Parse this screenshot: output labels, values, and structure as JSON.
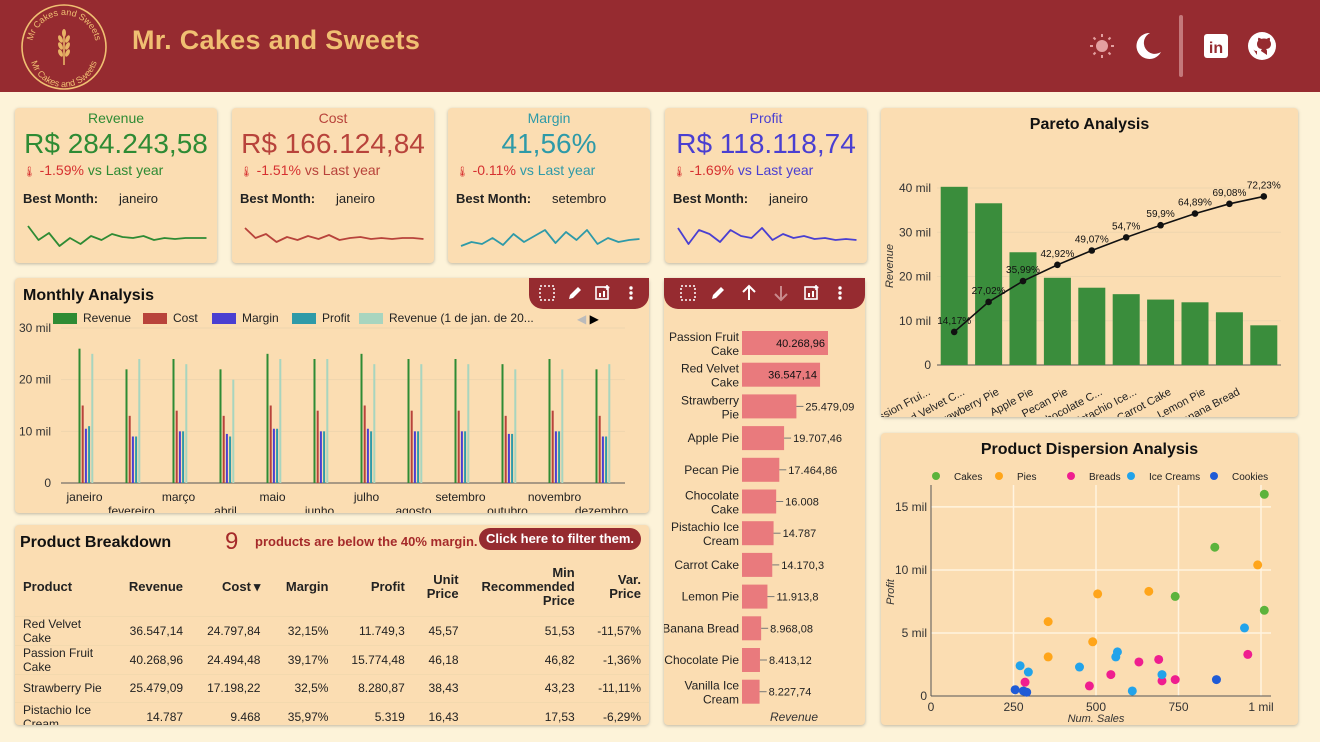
{
  "header": {
    "title": "Mr. Cakes and Sweets",
    "logo_text_top": "Mr Cakes and Sweets",
    "logo_text_bottom": "Mr Cakes and Sweets",
    "icons": [
      "sun-icon",
      "moon-icon",
      "linkedin-icon",
      "github-icon"
    ],
    "linkedin_label": "in"
  },
  "kpis": [
    {
      "title": "Revenue",
      "value": "R$ 284.243,58",
      "delta": "-1.59%",
      "delta_suffix": "vs Last year",
      "best_label": "Best Month:",
      "best_month": "janeiro",
      "color": "#2e8b34"
    },
    {
      "title": "Cost",
      "value": "R$ 166.124,84",
      "delta": "-1.51%",
      "delta_suffix": "vs Last year",
      "best_label": "Best Month:",
      "best_month": "janeiro",
      "color": "#b8433b"
    },
    {
      "title": "Margin",
      "value": "41,56%",
      "delta": "-0.11%",
      "delta_suffix": "vs Last year",
      "best_label": "Best Month:",
      "best_month": "setembro",
      "color": "#2e9aa8"
    },
    {
      "title": "Profit",
      "value": "R$ 118.118,74",
      "delta": "-1.69%",
      "delta_suffix": "vs Last year",
      "best_label": "Best Month:",
      "best_month": "janeiro",
      "color": "#4a3fd1"
    }
  ],
  "monthly": {
    "title": "Monthly Analysis",
    "legend": [
      {
        "name": "Revenue",
        "color": "#2e8b34"
      },
      {
        "name": "Cost",
        "color": "#b8433b"
      },
      {
        "name": "Margin",
        "color": "#4a3fd1"
      },
      {
        "name": "Profit",
        "color": "#2e9aa8"
      },
      {
        "name": "Revenue (1 de jan. de 20...",
        "color": "#a8d5bf"
      }
    ],
    "yticks": [
      "30 mil",
      "20 mil",
      "10 mil",
      "0"
    ]
  },
  "product_breakdown": {
    "title": "Product Breakdown",
    "count": "9",
    "message": "products are below the 40% margin.",
    "filter_button": "Click here to filter them.",
    "columns": [
      "Product",
      "Revenue",
      "Cost",
      "Margin",
      "Profit",
      "Unit Price",
      "Min Recommended Price",
      "Var. Price"
    ],
    "sort_indicator": "▾",
    "rows": [
      [
        "Red Velvet Cake",
        "36.547,14",
        "24.797,84",
        "32,15%",
        "11.749,3",
        "45,57",
        "51,53",
        "-11,57%"
      ],
      [
        "Passion Fruit Cake",
        "40.268,96",
        "24.494,48",
        "39,17%",
        "15.774,48",
        "46,18",
        "46,82",
        "-1,36%"
      ],
      [
        "Strawberry Pie",
        "25.479,09",
        "17.198,22",
        "32,5%",
        "8.280,87",
        "38,43",
        "43,23",
        "-11,11%"
      ],
      [
        "Pistachio Ice Cream",
        "14.787",
        "9.468",
        "35,97%",
        "5.319",
        "16,43",
        "17,53",
        "-6,29%"
      ]
    ]
  },
  "revenue_bar": {
    "axis_label": "Revenue"
  },
  "pareto": {
    "title": "Pareto Analysis",
    "ylabel": "Revenue",
    "yticks": [
      "40 mil",
      "30 mil",
      "20 mil",
      "10 mil",
      "0"
    ]
  },
  "dispersion": {
    "title": "Product Dispersion Analysis",
    "ylabel": "Profit",
    "xlabel": "Num. Sales",
    "yticks": [
      "15 mil",
      "10 mil",
      "5 mil",
      "0"
    ],
    "xticks": [
      "0",
      "250",
      "500",
      "750",
      "1 mil"
    ]
  },
  "chart_data": [
    {
      "type": "bar",
      "title": "Monthly Analysis",
      "categories": [
        "janeiro",
        "fevereiro",
        "março",
        "abril",
        "maio",
        "junho",
        "julho",
        "agosto",
        "setembro",
        "outubro",
        "novembro",
        "dezembro"
      ],
      "ylim": [
        0,
        30000
      ],
      "series": [
        {
          "name": "Revenue",
          "values": [
            26000,
            22000,
            24000,
            22000,
            25000,
            24000,
            25000,
            24000,
            24000,
            23000,
            24000,
            22000
          ]
        },
        {
          "name": "Cost",
          "values": [
            15000,
            13000,
            14000,
            13000,
            15000,
            14000,
            15000,
            14000,
            14000,
            13000,
            14000,
            13000
          ]
        },
        {
          "name": "Margin",
          "values": [
            10500,
            9000,
            10000,
            9500,
            10500,
            10000,
            10500,
            10000,
            10000,
            9500,
            10000,
            9000
          ]
        },
        {
          "name": "Profit",
          "values": [
            11000,
            9000,
            10000,
            9000,
            10500,
            10000,
            10000,
            10000,
            10000,
            9500,
            10000,
            9000
          ]
        },
        {
          "name": "Revenue (1 de jan. de 20...",
          "values": [
            25000,
            24000,
            23000,
            20000,
            24000,
            24000,
            23000,
            23000,
            23000,
            22000,
            22000,
            23000
          ]
        }
      ]
    },
    {
      "type": "bar",
      "orientation": "horizontal",
      "categories": [
        "Passion Fruit Cake",
        "Red Velvet Cake",
        "Strawberry Pie",
        "Apple Pie",
        "Pecan Pie",
        "Chocolate Cake",
        "Pistachio Ice Cream",
        "Carrot Cake",
        "Lemon Pie",
        "Banana Bread",
        "Chocolate Pie",
        "Vanilla Ice Cream"
      ],
      "values": [
        40268.96,
        36547.14,
        25479.09,
        19707.46,
        17464.86,
        16008,
        14787,
        14170.3,
        11913.8,
        8968.08,
        8413.12,
        8227.74
      ],
      "labels": [
        "40.268,96",
        "36.547,14",
        "25.479,09",
        "19.707,46",
        "17.464,86",
        "16.008",
        "14.787",
        "14.170,3",
        "11.913,8",
        "8.968,08",
        "8.413,12",
        "8.227,74"
      ],
      "xlabel": "Revenue"
    },
    {
      "type": "bar",
      "title": "Pareto Analysis",
      "categories": [
        "Passion Frui...",
        "Red Velvet C...",
        "Strawberry Pie",
        "Apple Pie",
        "Pecan Pie",
        "Chocolate C...",
        "Pistachio Ice...",
        "Carrot Cake",
        "Lemon Pie",
        "Banana Bread"
      ],
      "values": [
        40269,
        36547,
        25479,
        19707,
        17465,
        16008,
        14787,
        14170,
        11914,
        8968
      ],
      "cumulative_pct": [
        14.17,
        27.02,
        35.99,
        42.92,
        49.07,
        54.7,
        59.9,
        64.89,
        69.08,
        72.23
      ],
      "cumulative_labels": [
        "14,17%",
        "27,02%",
        "35,99%",
        "42,92%",
        "49,07%",
        "54,7%",
        "59,9%",
        "64,89%",
        "69,08%",
        "72,23%"
      ],
      "ylabel": "Revenue",
      "ylim": [
        0,
        40000
      ]
    },
    {
      "type": "scatter",
      "title": "Product Dispersion Analysis",
      "xlabel": "Num. Sales",
      "ylabel": "Profit",
      "xlim": [
        0,
        1000
      ],
      "ylim": [
        0,
        16500
      ],
      "series": [
        {
          "name": "Cakes",
          "color": "#5cb33c",
          "points": [
            [
              1010,
              16000
            ],
            [
              860,
              11800
            ],
            [
              740,
              7900
            ],
            [
              1010,
              6800
            ]
          ]
        },
        {
          "name": "Pies",
          "color": "#ffa51a",
          "points": [
            [
              990,
              10400
            ],
            [
              660,
              8300
            ],
            [
              505,
              8100
            ],
            [
              355,
              5900
            ],
            [
              490,
              4300
            ],
            [
              355,
              3100
            ]
          ]
        },
        {
          "name": "Breads",
          "color": "#ef1e8f",
          "points": [
            [
              285,
              1100
            ],
            [
              545,
              1700
            ],
            [
              630,
              2700
            ],
            [
              690,
              2900
            ],
            [
              740,
              1300
            ],
            [
              700,
              1200
            ],
            [
              960,
              3300
            ],
            [
              480,
              800
            ]
          ]
        },
        {
          "name": "Ice Creams",
          "color": "#22a3ea",
          "points": [
            [
              270,
              2400
            ],
            [
              295,
              1900
            ],
            [
              450,
              2300
            ],
            [
              565,
              3500
            ],
            [
              560,
              3100
            ],
            [
              700,
              1700
            ],
            [
              610,
              400
            ],
            [
              950,
              5400
            ]
          ]
        },
        {
          "name": "Cookies",
          "color": "#1f5bd6",
          "points": [
            [
              255,
              500
            ],
            [
              280,
              400
            ],
            [
              290,
              300
            ],
            [
              865,
              1300
            ]
          ]
        }
      ]
    }
  ]
}
